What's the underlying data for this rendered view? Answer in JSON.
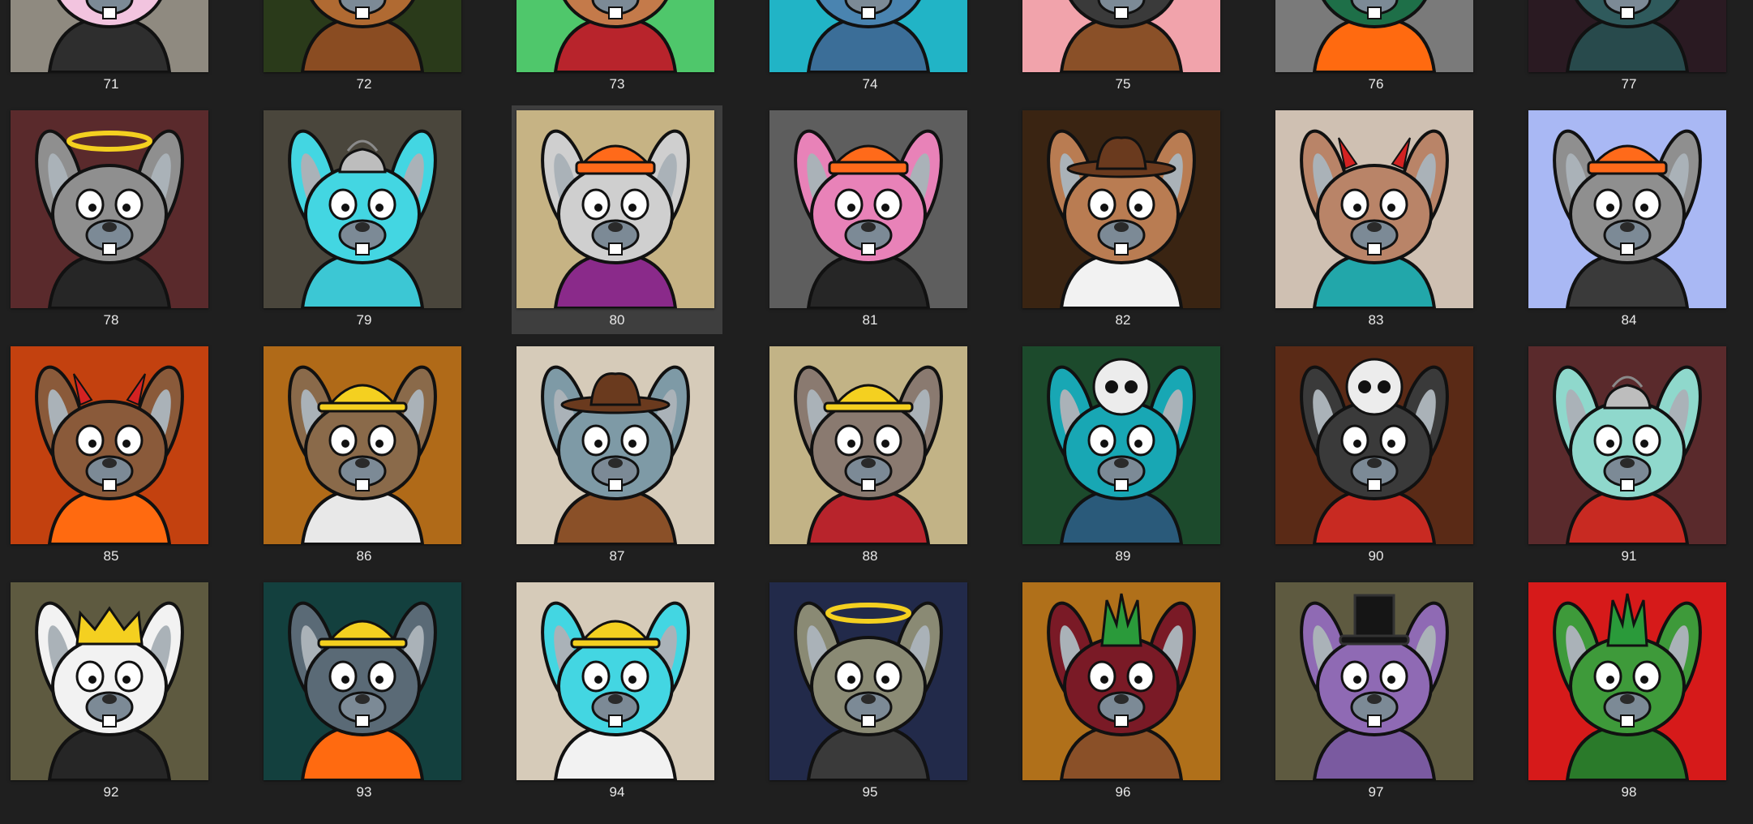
{
  "gallery": {
    "selected": "80",
    "items": [
      {
        "label": "71",
        "bg": "#8f8a80",
        "fur": "#f2c4df",
        "outfit": "#2e2e2e",
        "hat": "none",
        "hatColor": ""
      },
      {
        "label": "72",
        "bg": "#2a3a1a",
        "fur": "#b06a32",
        "outfit": "#8a4c22",
        "hat": "none",
        "hatColor": ""
      },
      {
        "label": "73",
        "bg": "#4fc76b",
        "fur": "#c47a4a",
        "outfit": "#b8242c",
        "hat": "none",
        "hatColor": ""
      },
      {
        "label": "74",
        "bg": "#21b4c6",
        "fur": "#4a84b0",
        "outfit": "#3b6e98",
        "hat": "none",
        "hatColor": ""
      },
      {
        "label": "75",
        "bg": "#f1a3ab",
        "fur": "#3a3a3a",
        "outfit": "#8a5028",
        "hat": "none",
        "hatColor": ""
      },
      {
        "label": "76",
        "bg": "#7a7a7a",
        "fur": "#1e6f48",
        "outfit": "#ff6a10",
        "hat": "none",
        "hatColor": ""
      },
      {
        "label": "77",
        "bg": "#2a1a22",
        "fur": "#2f5a5c",
        "outfit": "#284a4c",
        "hat": "none",
        "hatColor": ""
      },
      {
        "label": "78",
        "bg": "#5a2a2c",
        "fur": "#8f8f8f",
        "outfit": "#262626",
        "hat": "halo",
        "hatColor": "#f4d020"
      },
      {
        "label": "79",
        "bg": "#4a463c",
        "fur": "#43d6e2",
        "outfit": "#3cc7d4",
        "hat": "swirl",
        "hatColor": "#bdbdbd"
      },
      {
        "label": "80",
        "bg": "#c6b384",
        "fur": "#cfcfcf",
        "outfit": "#8a2a8a",
        "hat": "beanie",
        "hatColor": "#ff6a1a"
      },
      {
        "label": "81",
        "bg": "#5e5e5e",
        "fur": "#e882b8",
        "outfit": "#262626",
        "hat": "beanie",
        "hatColor": "#ff6a1a"
      },
      {
        "label": "82",
        "bg": "#3a2412",
        "fur": "#b97c52",
        "outfit": "#f2f2f2",
        "hat": "cowboy",
        "hatColor": "#6a3a1e"
      },
      {
        "label": "83",
        "bg": "#cfc0b2",
        "fur": "#b98468",
        "outfit": "#22a7aa",
        "hat": "horns",
        "hatColor": "#d42222"
      },
      {
        "label": "84",
        "bg": "#a9b8f4",
        "fur": "#8f8f8f",
        "outfit": "#3a3a3a",
        "hat": "beanie",
        "hatColor": "#ff6a1a"
      },
      {
        "label": "85",
        "bg": "#c3410f",
        "fur": "#8a5a3a",
        "outfit": "#ff6a10",
        "hat": "horns",
        "hatColor": "#d42222"
      },
      {
        "label": "86",
        "bg": "#b06a18",
        "fur": "#8a6a4a",
        "outfit": "#e8e8e8",
        "hat": "hardhat",
        "hatColor": "#f4d020"
      },
      {
        "label": "87",
        "bg": "#d6cbb9",
        "fur": "#7e9aa6",
        "outfit": "#8a5028",
        "hat": "cowboy",
        "hatColor": "#6a3a1e"
      },
      {
        "label": "88",
        "bg": "#c2b386",
        "fur": "#8a7a70",
        "outfit": "#b8242c",
        "hat": "hardhat",
        "hatColor": "#f4d020"
      },
      {
        "label": "89",
        "bg": "#1c4a2c",
        "fur": "#18a7b4",
        "outfit": "#2a5a7a",
        "hat": "skull",
        "hatColor": "#ececec"
      },
      {
        "label": "90",
        "bg": "#5a2a16",
        "fur": "#3a3a3a",
        "outfit": "#c82a22",
        "hat": "skull",
        "hatColor": "#ececec"
      },
      {
        "label": "91",
        "bg": "#5a2a2c",
        "fur": "#8fd8cc",
        "outfit": "#c82a22",
        "hat": "swirl",
        "hatColor": "#bdbdbd"
      },
      {
        "label": "92",
        "bg": "#5e5a40",
        "fur": "#f2f2f2",
        "outfit": "#262626",
        "hat": "crown",
        "hatColor": "#f4d020"
      },
      {
        "label": "93",
        "bg": "#13403e",
        "fur": "#5a6a76",
        "outfit": "#ff6a10",
        "hat": "hardhat",
        "hatColor": "#f4d020"
      },
      {
        "label": "94",
        "bg": "#d6cbb9",
        "fur": "#43d6e2",
        "outfit": "#f2f2f2",
        "hat": "hardhat",
        "hatColor": "#f4d020"
      },
      {
        "label": "95",
        "bg": "#222a4a",
        "fur": "#8a8a74",
        "outfit": "#3a3a3a",
        "hat": "halo",
        "hatColor": "#f4d020"
      },
      {
        "label": "96",
        "bg": "#b0701a",
        "fur": "#7a1a26",
        "outfit": "#8a5028",
        "hat": "mohawk",
        "hatColor": "#2a9a3a"
      },
      {
        "label": "97",
        "bg": "#5e5a40",
        "fur": "#8f6ab4",
        "outfit": "#7a5aa0",
        "hat": "tophat",
        "hatColor": "#151515"
      },
      {
        "label": "98",
        "bg": "#d61a1a",
        "fur": "#3e9a3a",
        "outfit": "#2a7a2a",
        "hat": "mohawk",
        "hatColor": "#2a9a3a"
      }
    ]
  }
}
